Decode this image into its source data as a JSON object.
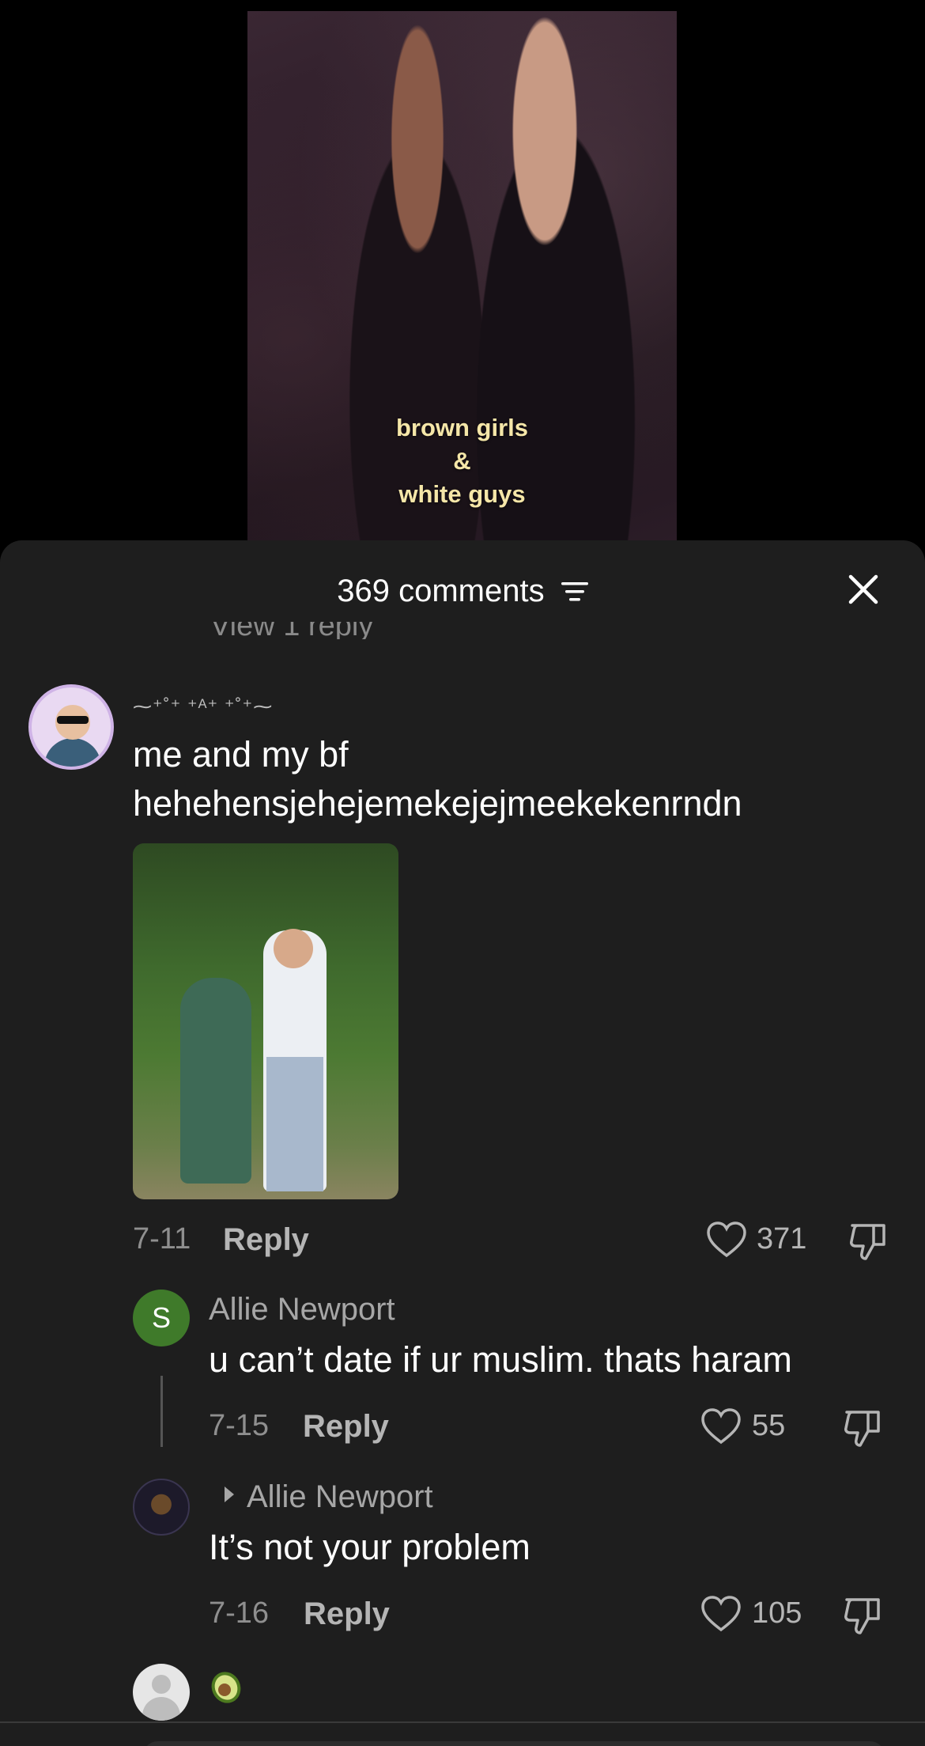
{
  "video": {
    "caption_lines": [
      "brown girls",
      "&",
      "white guys"
    ]
  },
  "sheet": {
    "title": "369 comments",
    "cutoff_text": "View 1 reply"
  },
  "comments": [
    {
      "decorated_name": "⁓⁺˚⁺ ⁺ᴬ⁺ ⁺˚⁺⁓",
      "text_line1": "me and my bf",
      "text_line2": "hehehensjehejemekejejmeekekenrndn",
      "date": "7-11",
      "reply_label": "Reply",
      "likes": "371"
    }
  ],
  "replies": [
    {
      "avatar_letter": "S",
      "name": "Allie Newport",
      "text": "u can’t date if ur muslim. thats haram",
      "date": "7-15",
      "reply_label": "Reply",
      "likes": "55"
    },
    {
      "name": "Allie Newport",
      "text": "It’s not your problem",
      "date": "7-16",
      "reply_label": "Reply",
      "likes": "105"
    }
  ],
  "colors": {
    "sheet_bg": "#1e1e1e",
    "caption": "#f5e6a8",
    "avatar_s": "#3f7a2a"
  },
  "icons": [
    "sort-icon",
    "close-icon",
    "heart-icon",
    "dislike-icon",
    "play-triangle-icon",
    "avocado-emoji"
  ]
}
